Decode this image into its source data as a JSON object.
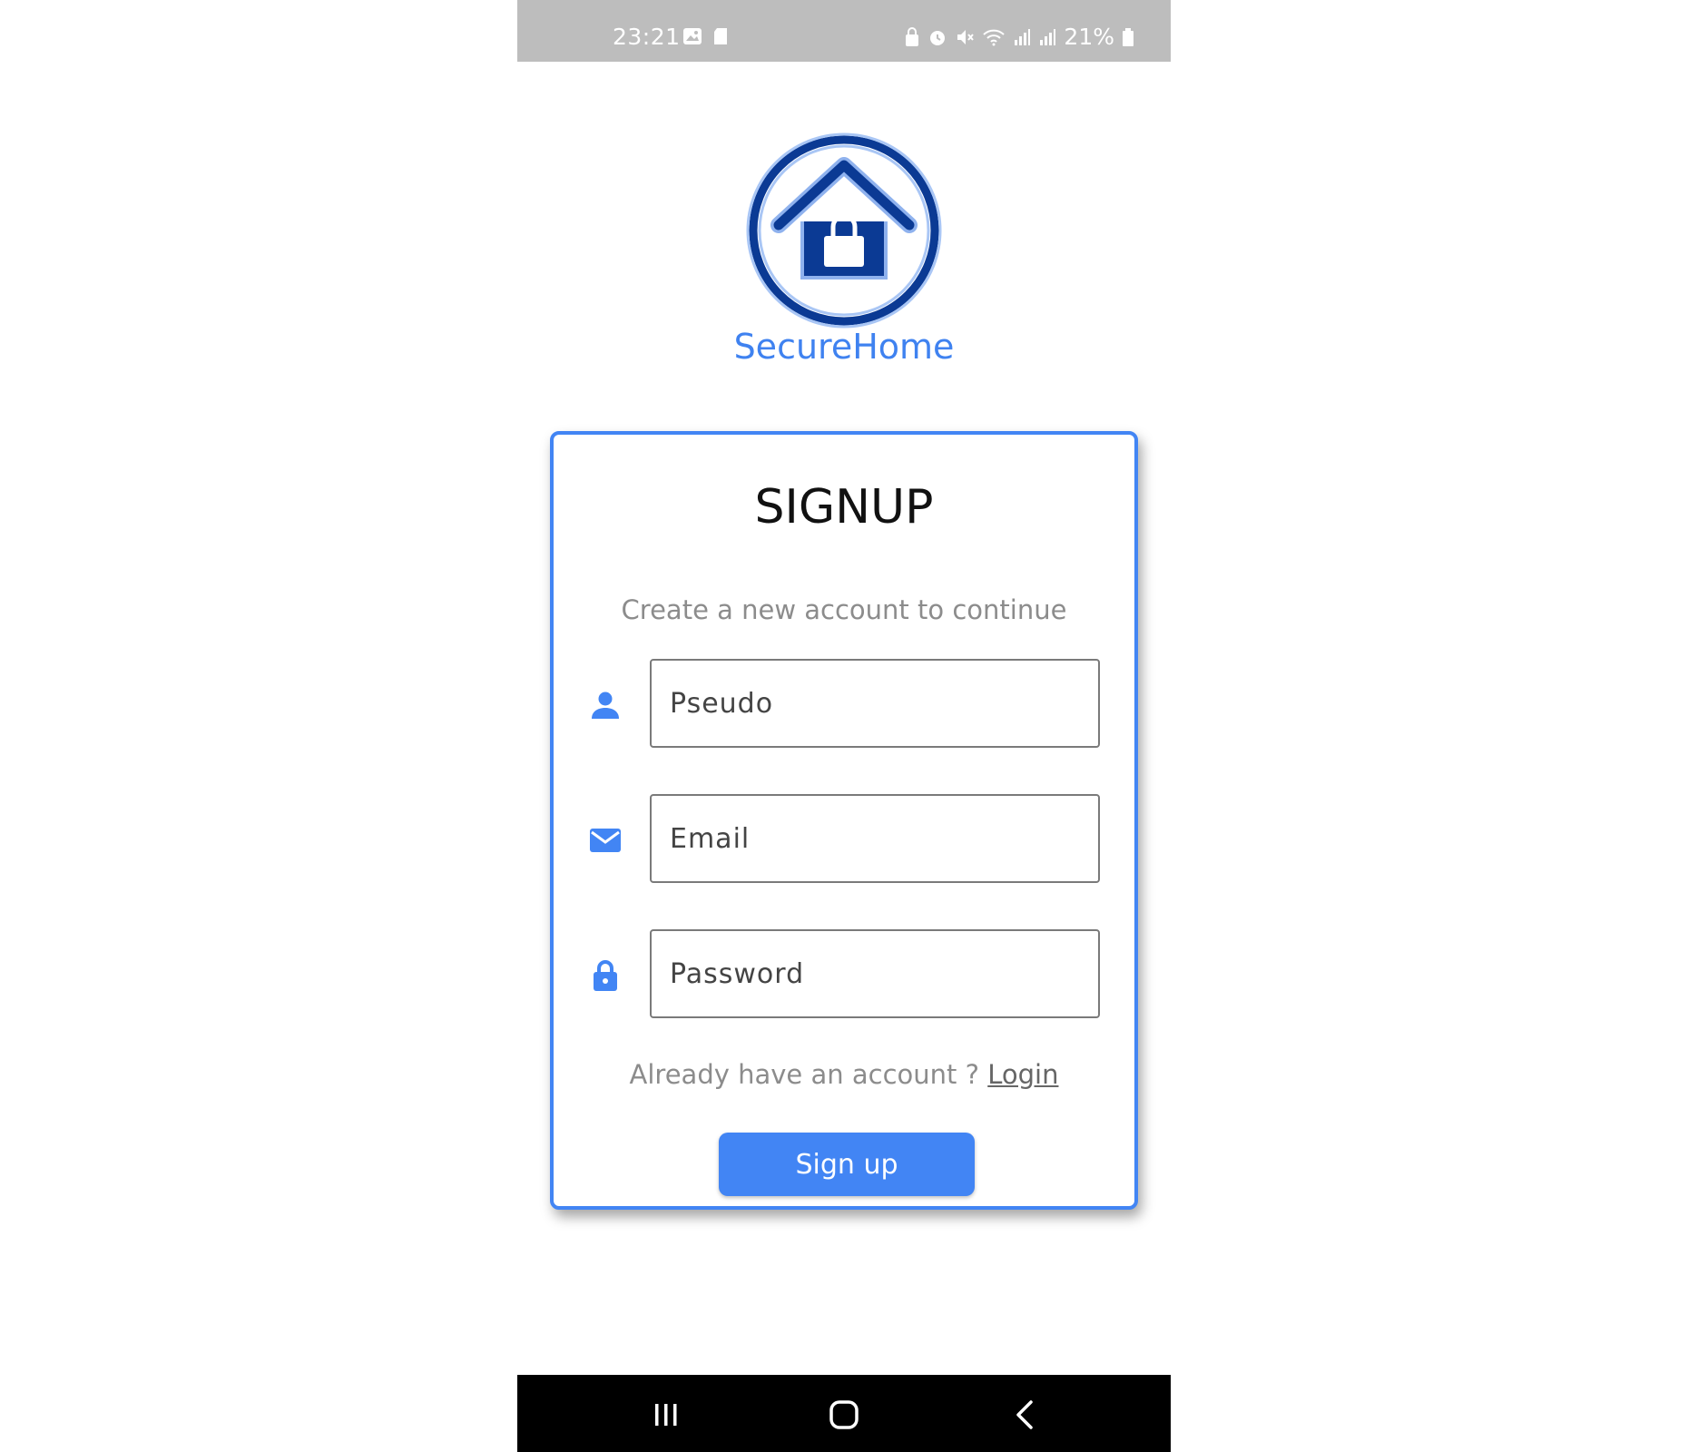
{
  "status_bar": {
    "time": "23:21",
    "battery": "21%",
    "left_icons": [
      "gallery-icon",
      "sd-card-icon"
    ],
    "right_icons": [
      "lock-status-icon",
      "alarm-icon",
      "mute-icon",
      "wifi-icon",
      "signal-icon",
      "signal-icon",
      "battery-icon"
    ]
  },
  "app": {
    "brand_name": "SecureHome",
    "logo_icon": "house-lock-icon"
  },
  "card": {
    "title": "SIGNUP",
    "subtitle": "Create a new account to continue",
    "fields": [
      {
        "icon": "person-icon",
        "placeholder": "Pseudo",
        "value": ""
      },
      {
        "icon": "mail-icon",
        "placeholder": "Email",
        "value": ""
      },
      {
        "icon": "lock-icon",
        "placeholder": "Password",
        "value": ""
      }
    ],
    "login_prompt": "Already have an account ? ",
    "login_link": "Login",
    "signup_button": "Sign up"
  },
  "nav_bar": {
    "buttons": [
      "recents-icon",
      "home-icon",
      "back-icon"
    ]
  },
  "colors": {
    "accent": "#4285f4",
    "brand_text": "#3f82f0",
    "logo_dark": "#0b3a94",
    "status_bar_bg": "#bdbdbd",
    "nav_bar_bg": "#000000"
  }
}
